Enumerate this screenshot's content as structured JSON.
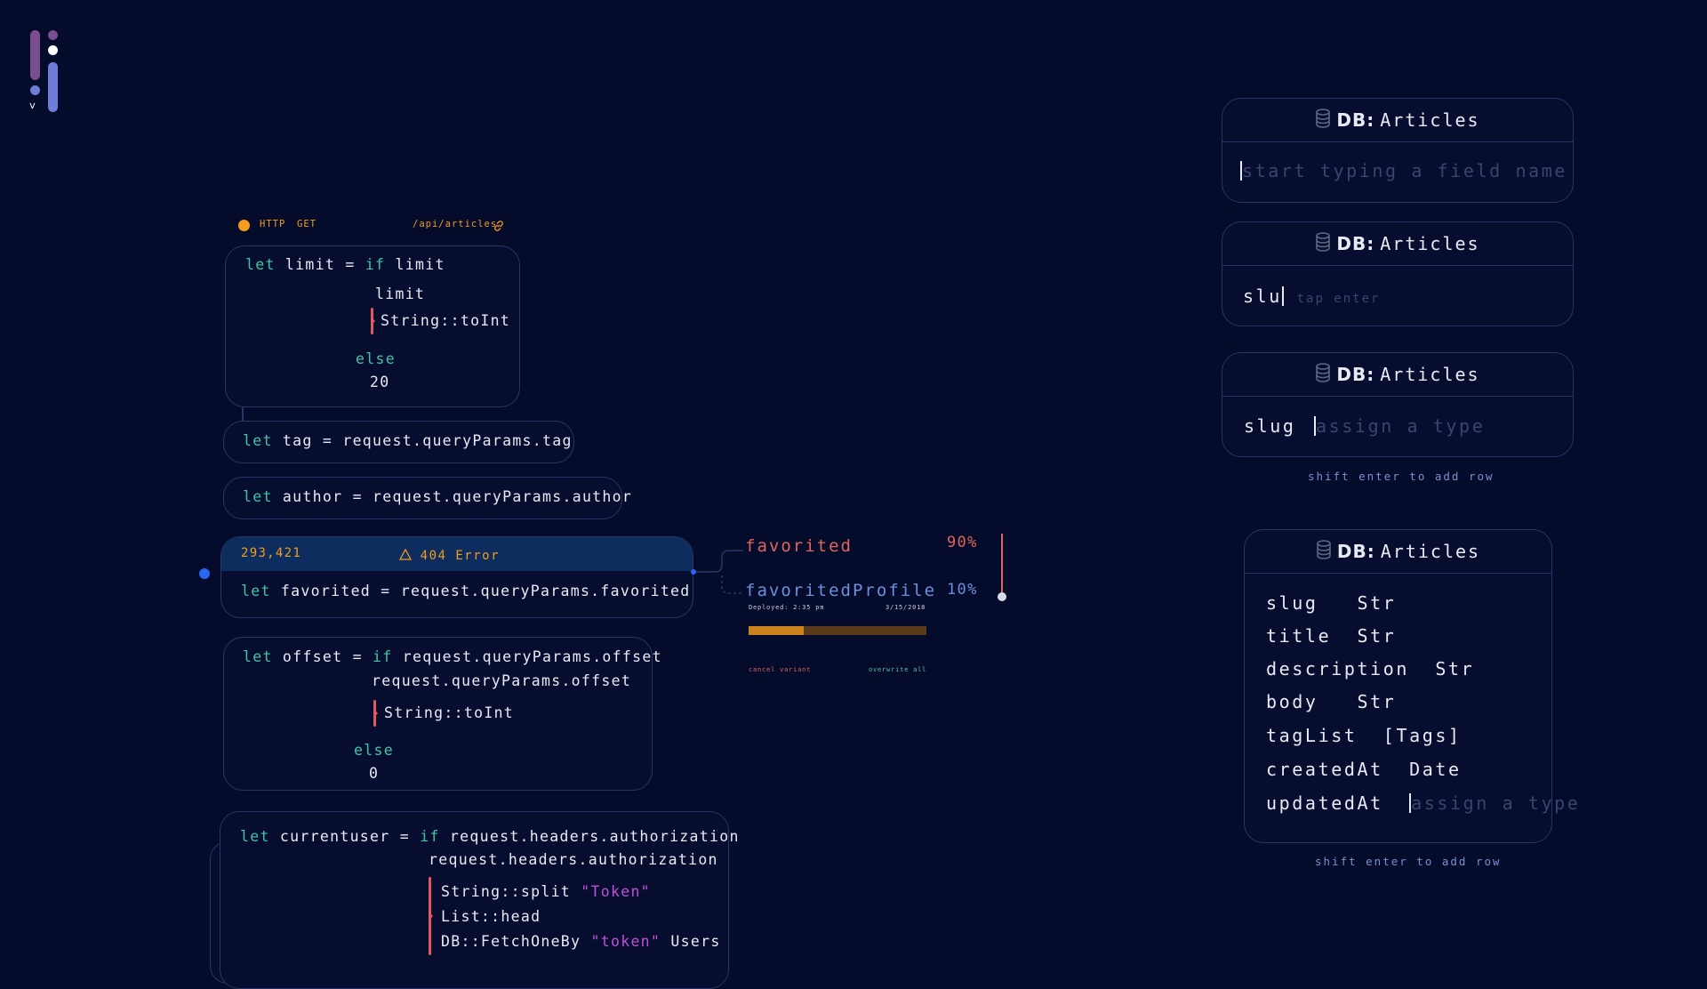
{
  "http": {
    "method_prefix": "HTTP",
    "method": "GET",
    "route": "/api/articles",
    "status_color": "#f39c1f"
  },
  "code": {
    "kw_let": "let",
    "kw_if": "if",
    "kw_else": "else",
    "limit": {
      "line1_rest": " limit = ",
      "line1_cond": " limit",
      "then": "limit",
      "pipe1": "String::toInt",
      "else_val": "20"
    },
    "tag_rest": " tag = request.queryParams.tag",
    "author_rest": " author = request.queryParams.author",
    "favorited": {
      "live_value": "293,421",
      "error_label": "404 Error",
      "rest": " favorited = request.queryParams.favorited"
    },
    "offset": {
      "line1_rest": " offset = ",
      "line1_cond": " request.queryParams.offset",
      "then": "request.queryParams.offset",
      "pipe1": "String::toInt",
      "else_val": "0"
    },
    "currentuser": {
      "line1_rest": " currentuser = ",
      "line1_cond": " request.headers.authorization",
      "then": "request.headers.authorization",
      "pipe1_fn": "String::split ",
      "pipe1_arg": "\"Token\"",
      "pipe2": "List::head",
      "pipe3_fn": "DB::FetchOneBy ",
      "pipe3_arg": "\"token\"",
      "pipe3_tail": " Users"
    }
  },
  "variants": {
    "a_name": "favorited",
    "a_pct": "90%",
    "a_color": "#e0655e",
    "b_name": "favoritedProfile",
    "b_pct": "10%",
    "b_color": "#6f8fdc",
    "deployed": "Deployed: 2:35 pm",
    "date": "3/15/2018",
    "progress": 0.31,
    "cancel": "cancel variant",
    "overwrite": "overwrite all"
  },
  "db_panels": {
    "label": "DB:",
    "name": "Articles",
    "p1_placeholder": "start typing a field name",
    "p2_value": "slu",
    "p2_hint": "tap enter",
    "p3_field": "slug",
    "p3_placeholder": "assign a type",
    "p3_hint": "shift enter to add row",
    "p4_rows": [
      {
        "field": "slug",
        "type": "Str"
      },
      {
        "field": "title",
        "type": "Str"
      },
      {
        "field": "description",
        "type": "Str"
      },
      {
        "field": "body",
        "type": "Str"
      },
      {
        "field": "tagList",
        "type": "[Tags]"
      },
      {
        "field": "createdAt",
        "type": "Date"
      }
    ],
    "p4_last_field": "updatedAt",
    "p4_placeholder": "assign a type",
    "p4_hint": "shift enter to add row"
  }
}
